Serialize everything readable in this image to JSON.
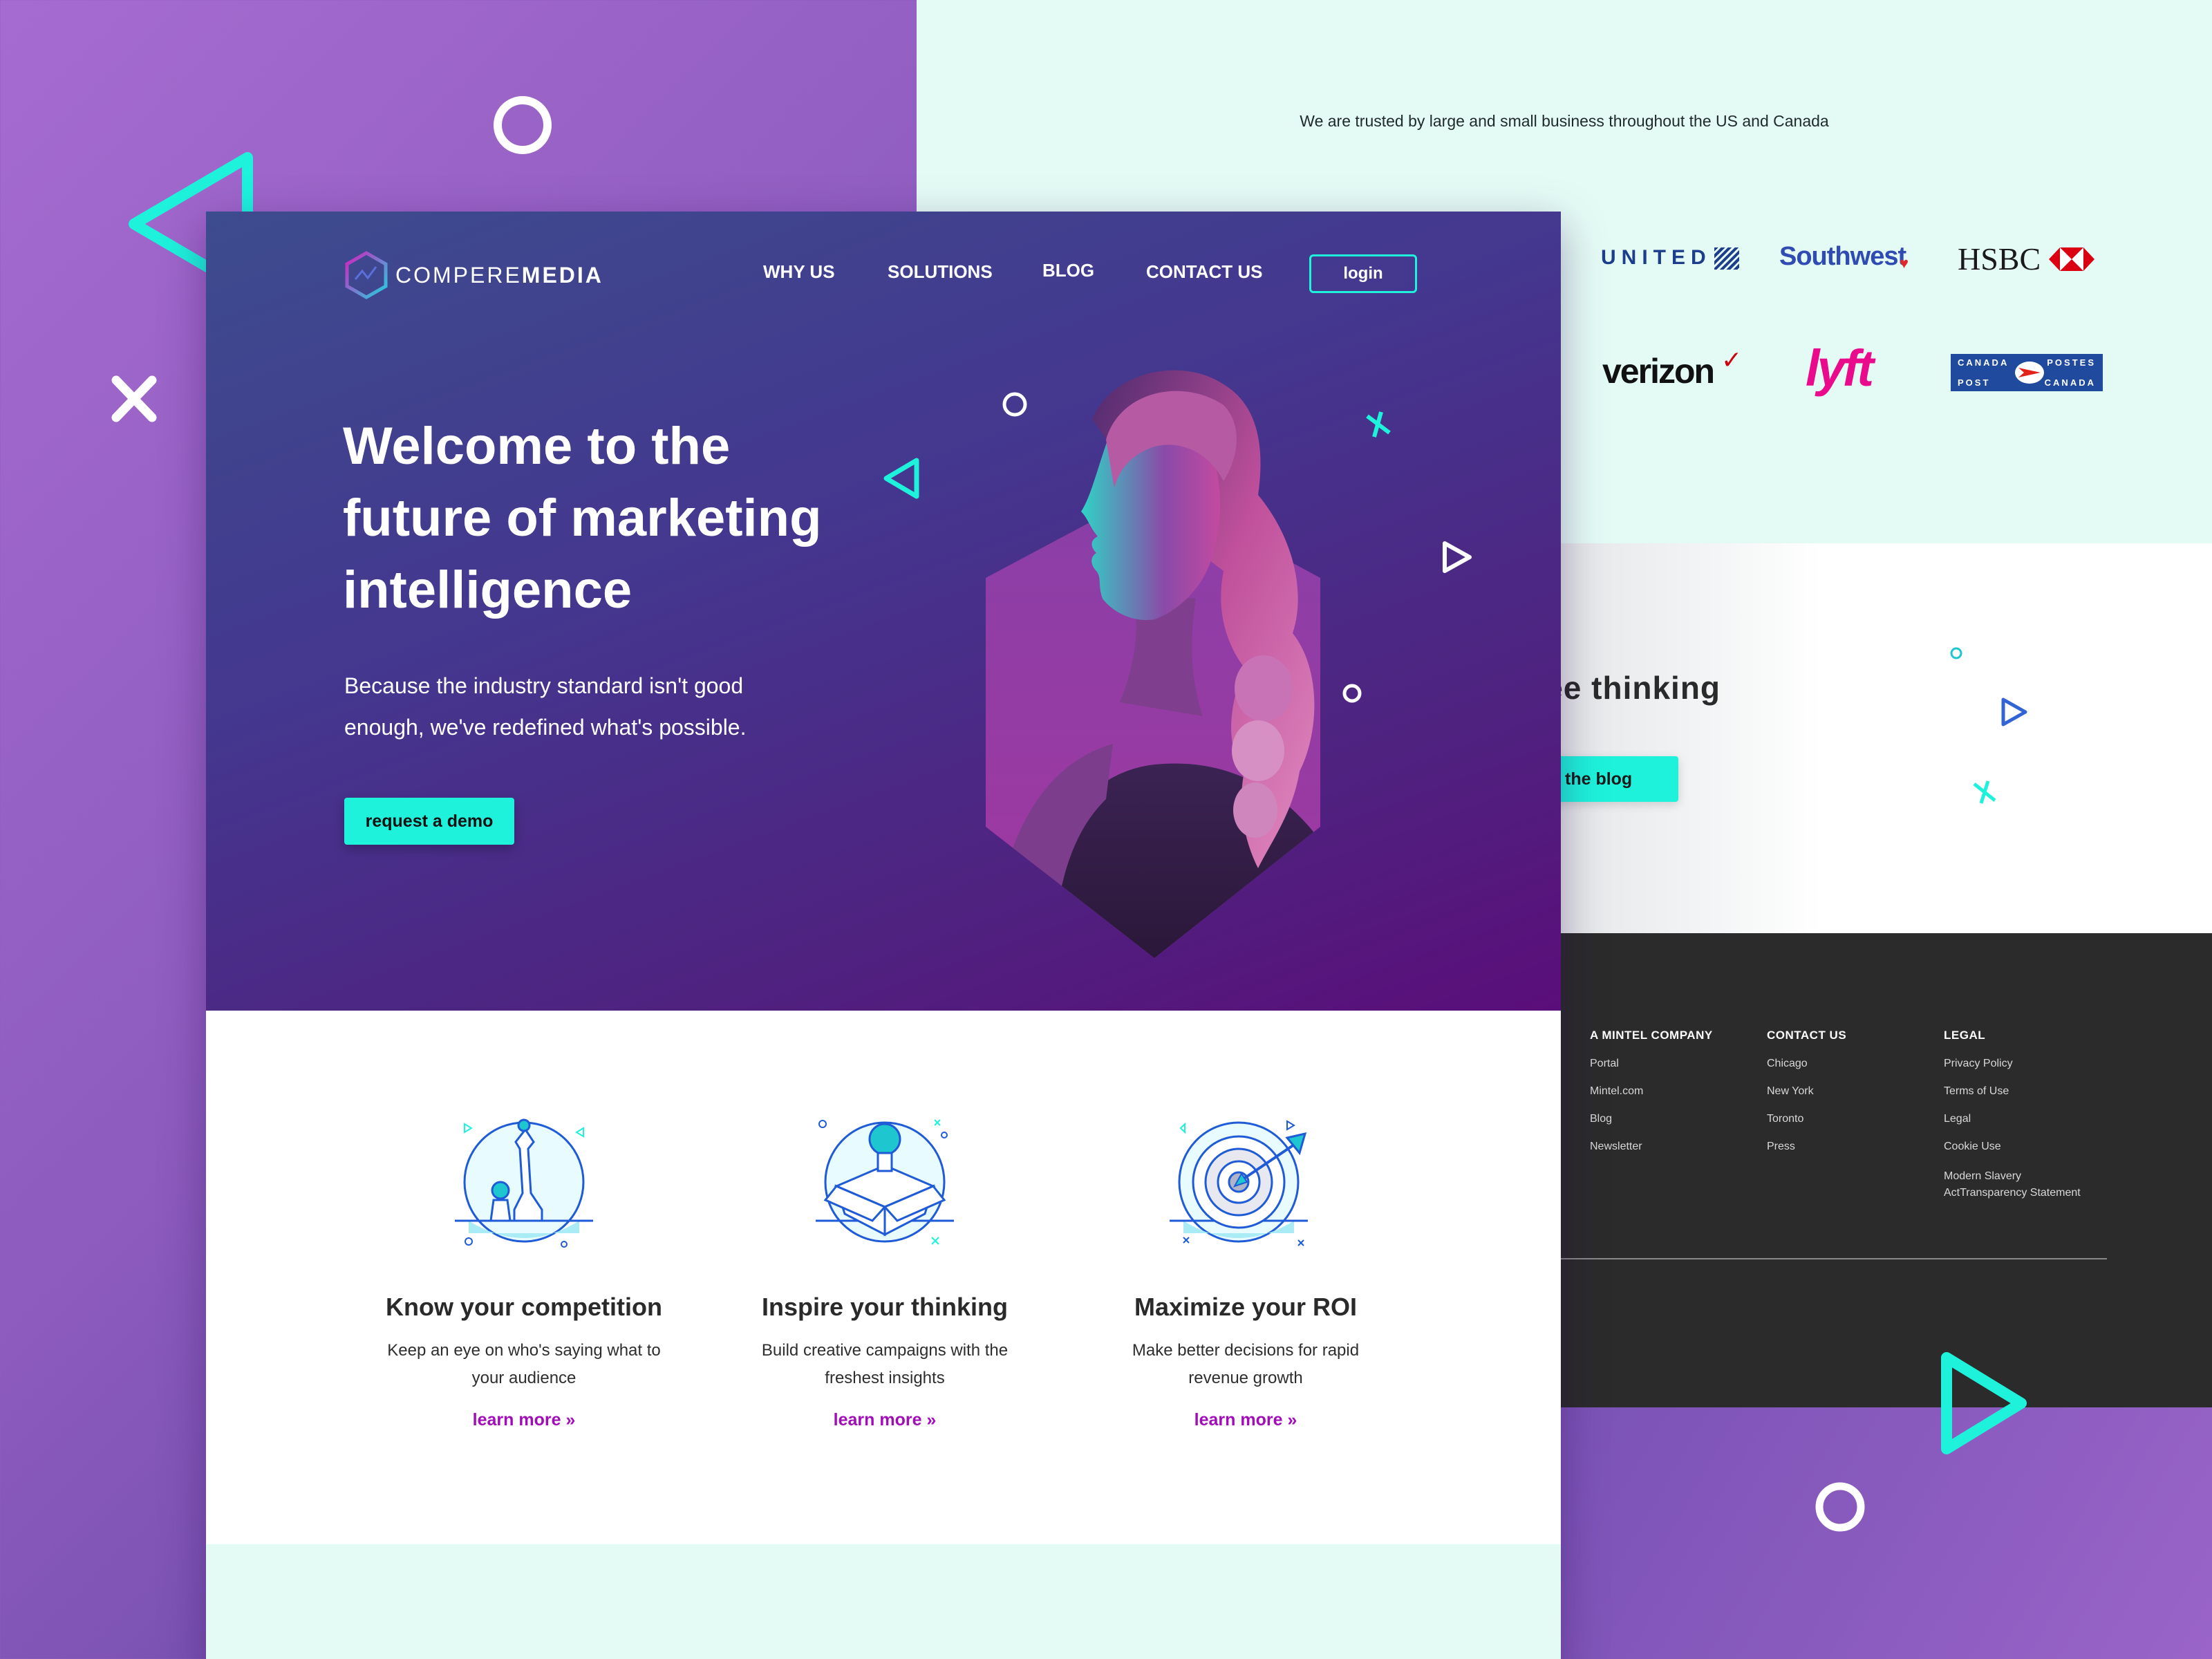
{
  "trusted": {
    "text": "We are trusted by large and small business throughout the US and Canada"
  },
  "logos": {
    "united": "UNITED",
    "southwest": "Southwest",
    "hsbc": "HSBC",
    "verizon": "verizon",
    "lyft": "lyft",
    "canada_post": {
      "tl": "CANADA",
      "tr": "POSTES",
      "bl": "POST",
      "br": "CANADA"
    }
  },
  "blog": {
    "heading": "free thinking",
    "button": "the blog"
  },
  "footer": {
    "columns": [
      {
        "heading": "A MINTEL COMPANY",
        "links": [
          "Portal",
          "Mintel.com",
          "Blog",
          "Newsletter"
        ]
      },
      {
        "heading": "CONTACT US",
        "links": [
          "Chicago",
          "New York",
          "Toronto",
          "Press"
        ]
      },
      {
        "heading": "LEGAL",
        "links": [
          "Privacy Policy",
          "Terms of Use",
          "Legal",
          "Cookie Use",
          "Modern Slavery\nActTransparency Statement"
        ]
      }
    ]
  },
  "brand": {
    "part1": "COMPERE",
    "part2": "MEDIA"
  },
  "nav": {
    "why_us": "WHY US",
    "solutions": "SOLUTIONS",
    "blog": "BLOG",
    "contact": "CONTACT US",
    "login": "login"
  },
  "hero": {
    "title": "Welcome to the future of marketing intelligence",
    "subtitle": "Because the industry standard isn't good enough, we've redefined what's possible.",
    "cta": "request a demo"
  },
  "features": [
    {
      "icon": "chess-pieces-icon",
      "title": "Know your competition",
      "desc": "Keep an eye on who's saying what to your audience",
      "link": "learn more »"
    },
    {
      "icon": "lightbulb-box-icon",
      "title": "Inspire your thinking",
      "desc": "Build creative campaigns with the freshest insights",
      "link": "learn more »"
    },
    {
      "icon": "target-arrow-icon",
      "title": "Maximize your ROI",
      "desc": "Make better decisions for rapid revenue growth",
      "link": "learn more »"
    }
  ],
  "colors": {
    "accent": "#1ef2db",
    "link": "#a10eb8",
    "hero_dark": "#5a0e79",
    "footer_bg": "#2b2b2b",
    "mint": "#e4fbf5"
  }
}
